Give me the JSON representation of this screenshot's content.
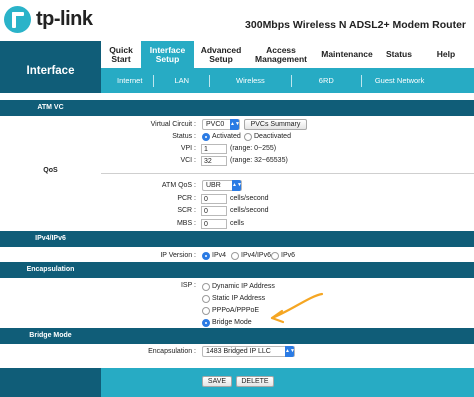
{
  "header": {
    "logo_text": "tp-link",
    "model": "300Mbps Wireless N ADSL2+ Modem Router"
  },
  "nav": {
    "section_title": "Interface",
    "menu": [
      {
        "label": "Quick Start"
      },
      {
        "label": "Interface Setup",
        "active": true
      },
      {
        "label": "Advanced Setup"
      },
      {
        "label": "Access Management"
      },
      {
        "label": "Maintenance"
      },
      {
        "label": "Status"
      },
      {
        "label": "Help"
      }
    ],
    "submenu": [
      "Internet",
      "LAN",
      "Wireless",
      "6RD",
      "Guest Network"
    ]
  },
  "sections": {
    "atm_vc": "ATM VC",
    "qos": "QoS",
    "ipv4_ipv6": "IPv4/IPv6",
    "encapsulation": "Encapsulation",
    "bridge_mode": "Bridge Mode"
  },
  "atm_vc": {
    "virtual_circuit_label": "Virtual Circuit :",
    "virtual_circuit_value": "PVC0",
    "pvcs_summary_button": "PVCs Summary",
    "status_label": "Status :",
    "status_options": [
      "Activated",
      "Deactivated"
    ],
    "status_selected": "Activated",
    "vpi_label": "VPI :",
    "vpi_value": "1",
    "vpi_range": "(range: 0~255)",
    "vci_label": "VCI :",
    "vci_value": "32",
    "vci_range": "(range: 32~65535)"
  },
  "qos": {
    "atm_qos_label": "ATM QoS :",
    "atm_qos_value": "UBR",
    "pcr_label": "PCR :",
    "pcr_value": "0",
    "scr_label": "SCR :",
    "scr_value": "0",
    "mbs_label": "MBS :",
    "mbs_value": "0",
    "unit_cells_second": "cells/second",
    "unit_cells": "cells"
  },
  "ip_version": {
    "label": "IP Version :",
    "options": [
      "IPv4",
      "IPv4/IPv6",
      "IPv6"
    ],
    "selected": "IPv4"
  },
  "encapsulation": {
    "isp_label": "ISP :",
    "options": [
      "Dynamic IP Address",
      "Static IP Address",
      "PPPoA/PPPoE",
      "Bridge Mode"
    ],
    "selected": "Bridge Mode"
  },
  "bridge": {
    "encapsulation_label": "Encapsulation :",
    "encapsulation_value": "1483 Bridged IP LLC"
  },
  "footer": {
    "save_label": "SAVE",
    "delete_label": "DELETE"
  },
  "colors": {
    "dark_teal": "#105d78",
    "teal": "#27abc4",
    "select_blue": "#2b7be4",
    "annotation_orange": "#f5a623"
  }
}
